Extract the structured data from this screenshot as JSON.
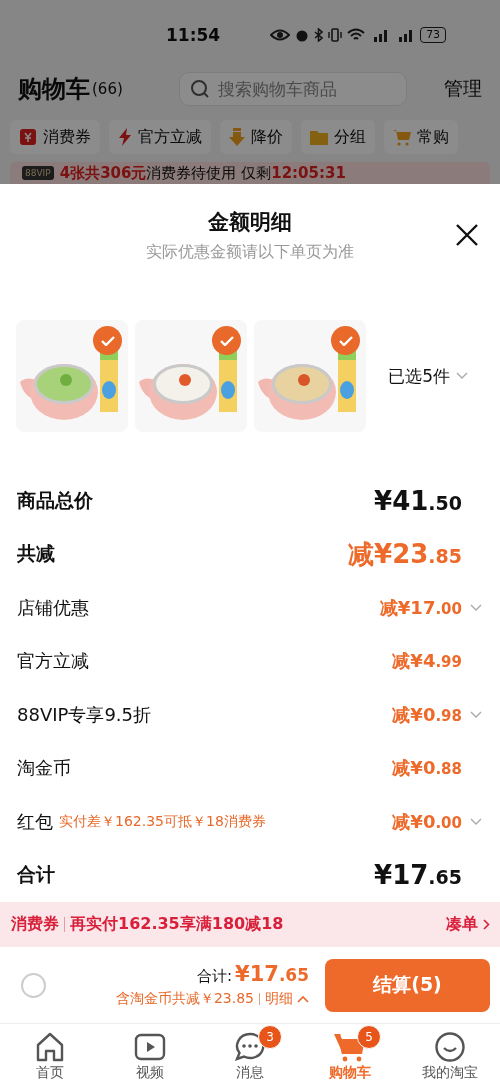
{
  "status_bar": {
    "time": "11:54",
    "battery": "73"
  },
  "header": {
    "title": "购物车",
    "count": "(66)",
    "search": {
      "placeholder": "搜索购物车商品"
    },
    "manage": "管理"
  },
  "chips": [
    {
      "kind": "coupon",
      "label": "消费券"
    },
    {
      "kind": "bolt",
      "label": "官方立减"
    },
    {
      "kind": "down",
      "label": "降价"
    },
    {
      "kind": "folder",
      "label": "分组"
    },
    {
      "kind": "cart",
      "label": "常购"
    }
  ],
  "banner": {
    "badge": "88VIP",
    "highlight": "4张共306元",
    "text": "消费券待使用 仅剩",
    "timer": "12:05:31"
  },
  "sheet": {
    "title": "金额明细",
    "subtitle": "实际优惠金额请以下单页为准",
    "products": [
      {
        "kind": "green",
        "selected": true
      },
      {
        "kind": "white",
        "selected": true
      },
      {
        "kind": "yellow",
        "selected": true
      }
    ],
    "selected_count": "已选5件",
    "rows": [
      {
        "kind": "total",
        "label": "商品总价",
        "amount": "¥41.50",
        "expandable": false
      },
      {
        "kind": "discount_total",
        "label": "共减",
        "amount": "减¥23.85",
        "expandable": false
      },
      {
        "kind": "discount",
        "label": "店铺优惠",
        "amount": "减¥17.00",
        "expandable": true
      },
      {
        "kind": "discount",
        "label": "官方立减",
        "amount": "减¥4.99",
        "expandable": false
      },
      {
        "kind": "discount",
        "label": "88VIP专享9.5折",
        "amount": "减¥0.98",
        "expandable": true
      },
      {
        "kind": "discount",
        "label": "淘金币",
        "amount": "减¥0.88",
        "expandable": false
      },
      {
        "kind": "discount",
        "label": "红包",
        "note": "实付差￥162.35可抵￥18消费券",
        "amount": "减¥0.00",
        "expandable": true
      },
      {
        "kind": "total",
        "label": "合计",
        "amount": "¥17.65",
        "expandable": false
      }
    ]
  },
  "coupon_bar": {
    "tag": "消费券",
    "text": "再实付162.35享满180减18",
    "action": "凑单"
  },
  "checkout": {
    "select_all": {
      "checked": false
    },
    "total_label": "合计:",
    "total": "¥17.65",
    "savings": "含淘金币共减￥23.85",
    "detail": "明细",
    "button": "结算(5)"
  },
  "nav": [
    {
      "kind": "home",
      "label": "首页",
      "selected": false
    },
    {
      "kind": "video",
      "label": "视频",
      "selected": false
    },
    {
      "kind": "message",
      "label": "消息",
      "badge": "3",
      "selected": false
    },
    {
      "kind": "cart",
      "label": "购物车",
      "badge": "5",
      "selected": true
    },
    {
      "kind": "profile",
      "label": "我的淘宝",
      "selected": false
    }
  ]
}
